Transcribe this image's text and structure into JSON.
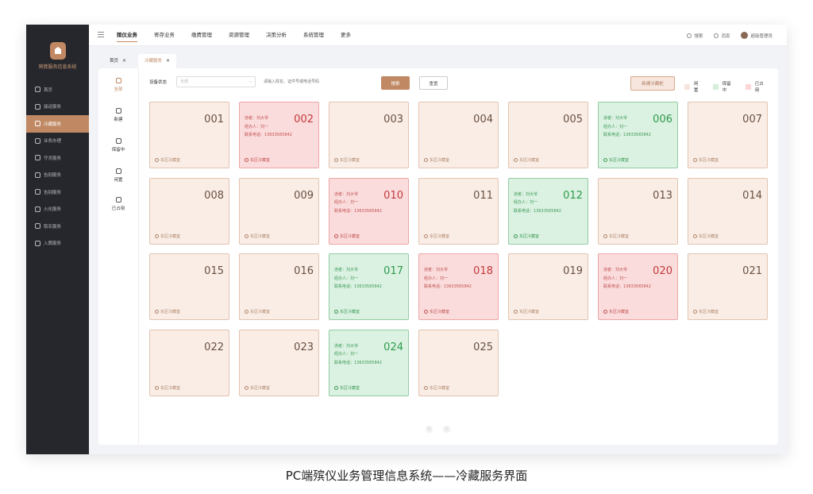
{
  "sidebar": {
    "brand": "殡葬服务信息系统",
    "items": [
      {
        "label": "首页",
        "active": false
      },
      {
        "label": "接运服务",
        "active": false
      },
      {
        "label": "冷藏服务",
        "active": true
      },
      {
        "label": "业务办理",
        "active": false
      },
      {
        "label": "守灵服务",
        "active": false
      },
      {
        "label": "告别服务",
        "active": false
      },
      {
        "label": "告别服务",
        "active": false
      },
      {
        "label": "火化服务",
        "active": false
      },
      {
        "label": "取灰服务",
        "active": false
      },
      {
        "label": "入葬服务",
        "active": false
      }
    ]
  },
  "topbar": {
    "menus": [
      "殡仪业务",
      "寄存业务",
      "缴费管理",
      "资源管理",
      "决策分析",
      "系统管理",
      "更多"
    ],
    "active_menu": "殡仪业务",
    "search": "搜索",
    "messages": "消息",
    "user": "超级管理员"
  },
  "tabs": [
    {
      "label": "首页",
      "close": "×"
    },
    {
      "label": "冷藏服务",
      "close": "×"
    }
  ],
  "leftcol": [
    {
      "label": "全部",
      "icon": "grid-icon"
    },
    {
      "label": "新建",
      "icon": "plus-icon"
    },
    {
      "label": "保留中",
      "icon": "hourglass-icon"
    },
    {
      "label": "闲置",
      "icon": "box-icon"
    },
    {
      "label": "已占用",
      "icon": "check-icon"
    }
  ],
  "filter": {
    "label": "设备状态",
    "select_value": "全部",
    "search_placeholder": "请输入姓名、证件号或电话号码",
    "search_button": "搜索",
    "reset_button": "重置",
    "new_button": "新建冷藏柜"
  },
  "legend": [
    {
      "label": "闲置",
      "color": "#f6e5dc"
    },
    {
      "label": "保留中",
      "color": "#d5efdc"
    },
    {
      "label": "已占用",
      "color": "#fbd6d6"
    }
  ],
  "card_labels": {
    "contact": "逝者：刘大爷",
    "handler": "经办人：刘一",
    "phone": "联系电话：13633565842",
    "location": "东区冷藏室"
  },
  "cards": [
    {
      "number": "001",
      "status": "free"
    },
    {
      "number": "002",
      "status": "occupied"
    },
    {
      "number": "003",
      "status": "free"
    },
    {
      "number": "004",
      "status": "free"
    },
    {
      "number": "005",
      "status": "free"
    },
    {
      "number": "006",
      "status": "reserved"
    },
    {
      "number": "007",
      "status": "free"
    },
    {
      "number": "008",
      "status": "free"
    },
    {
      "number": "009",
      "status": "free"
    },
    {
      "number": "010",
      "status": "occupied"
    },
    {
      "number": "011",
      "status": "free"
    },
    {
      "number": "012",
      "status": "reserved"
    },
    {
      "number": "013",
      "status": "free"
    },
    {
      "number": "014",
      "status": "free"
    },
    {
      "number": "015",
      "status": "free"
    },
    {
      "number": "016",
      "status": "free"
    },
    {
      "number": "017",
      "status": "reserved"
    },
    {
      "number": "018",
      "status": "occupied"
    },
    {
      "number": "019",
      "status": "free"
    },
    {
      "number": "020",
      "status": "occupied"
    },
    {
      "number": "021",
      "status": "free"
    },
    {
      "number": "022",
      "status": "free"
    },
    {
      "number": "023",
      "status": "free"
    },
    {
      "number": "024",
      "status": "reserved"
    },
    {
      "number": "025",
      "status": "free"
    }
  ],
  "pager": {
    "prev": "‹",
    "next": "›"
  },
  "caption": "PC端殡仪业务管理信息系统——冷藏服务界面"
}
